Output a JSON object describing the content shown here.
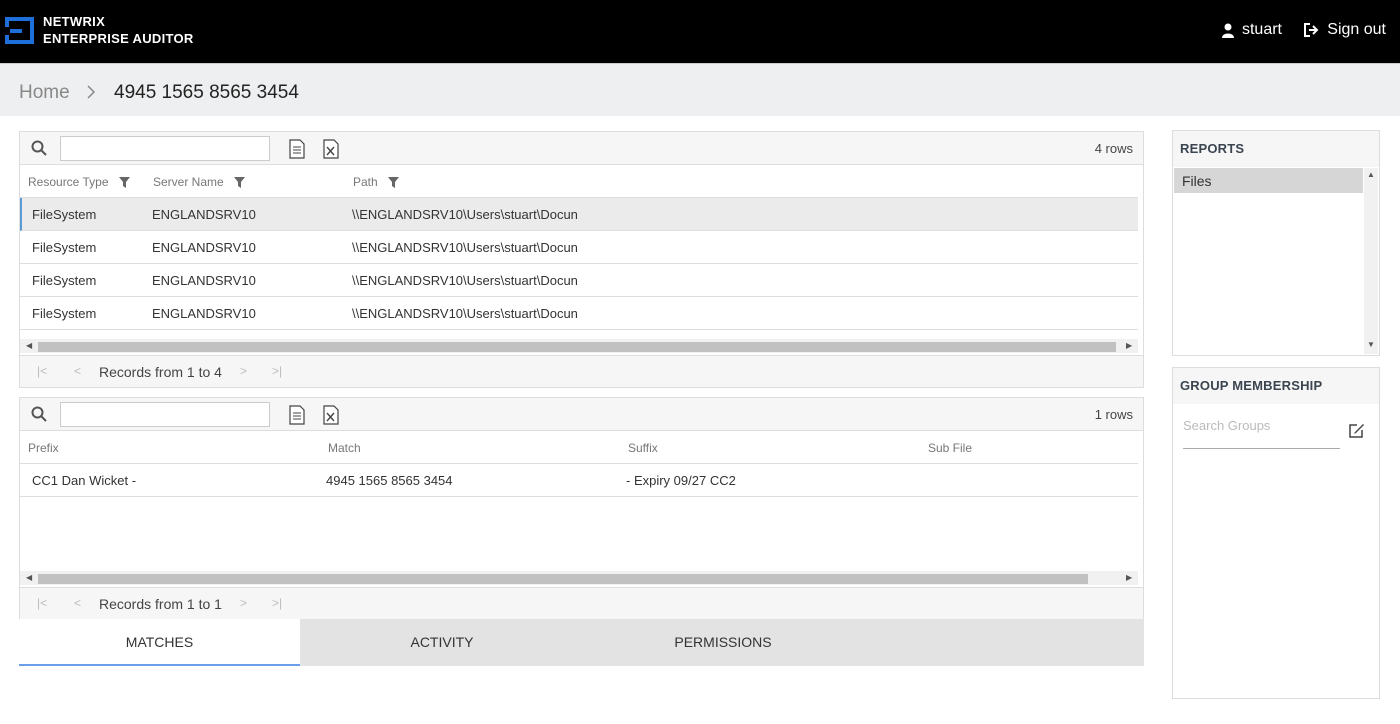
{
  "header": {
    "brand_line1": "NETWRIX",
    "brand_line2": "ENTERPRISE AUDITOR",
    "username": "stuart",
    "signout_label": "Sign out"
  },
  "breadcrumb": {
    "home": "Home",
    "separator": ">",
    "current": "4945 1565 8565 3454"
  },
  "grid1": {
    "row_count": "4 rows",
    "columns": [
      "Resource Type",
      "Server Name",
      "Path"
    ],
    "rows": [
      [
        "FileSystem",
        "ENGLANDSRV10",
        "\\\\ENGLANDSRV10\\Users\\stuart\\Docun"
      ],
      [
        "FileSystem",
        "ENGLANDSRV10",
        "\\\\ENGLANDSRV10\\Users\\stuart\\Docun"
      ],
      [
        "FileSystem",
        "ENGLANDSRV10",
        "\\\\ENGLANDSRV10\\Users\\stuart\\Docun"
      ],
      [
        "FileSystem",
        "ENGLANDSRV10",
        "\\\\ENGLANDSRV10\\Users\\stuart\\Docun"
      ]
    ],
    "pager_text": "Records from 1 to 4"
  },
  "grid2": {
    "row_count": "1 rows",
    "columns": [
      "Prefix",
      "Match",
      "Suffix",
      "Sub File"
    ],
    "rows": [
      [
        "CC1 Dan Wicket -",
        "4945 1565 8565 3454",
        "- Expiry 09/27 CC2",
        ""
      ]
    ],
    "pager_text": "Records from 1 to 1"
  },
  "tabs": [
    {
      "label": "MATCHES",
      "active": true
    },
    {
      "label": "ACTIVITY",
      "active": false
    },
    {
      "label": "PERMISSIONS",
      "active": false
    }
  ],
  "reports": {
    "title": "REPORTS",
    "items": [
      "Files"
    ]
  },
  "group_membership": {
    "title": "GROUP MEMBERSHIP",
    "search_placeholder": "Search Groups"
  },
  "colors": {
    "header_bg": "#000000",
    "accent_blue": "#1e6fd9",
    "tab_underline": "#6a9ee8"
  }
}
